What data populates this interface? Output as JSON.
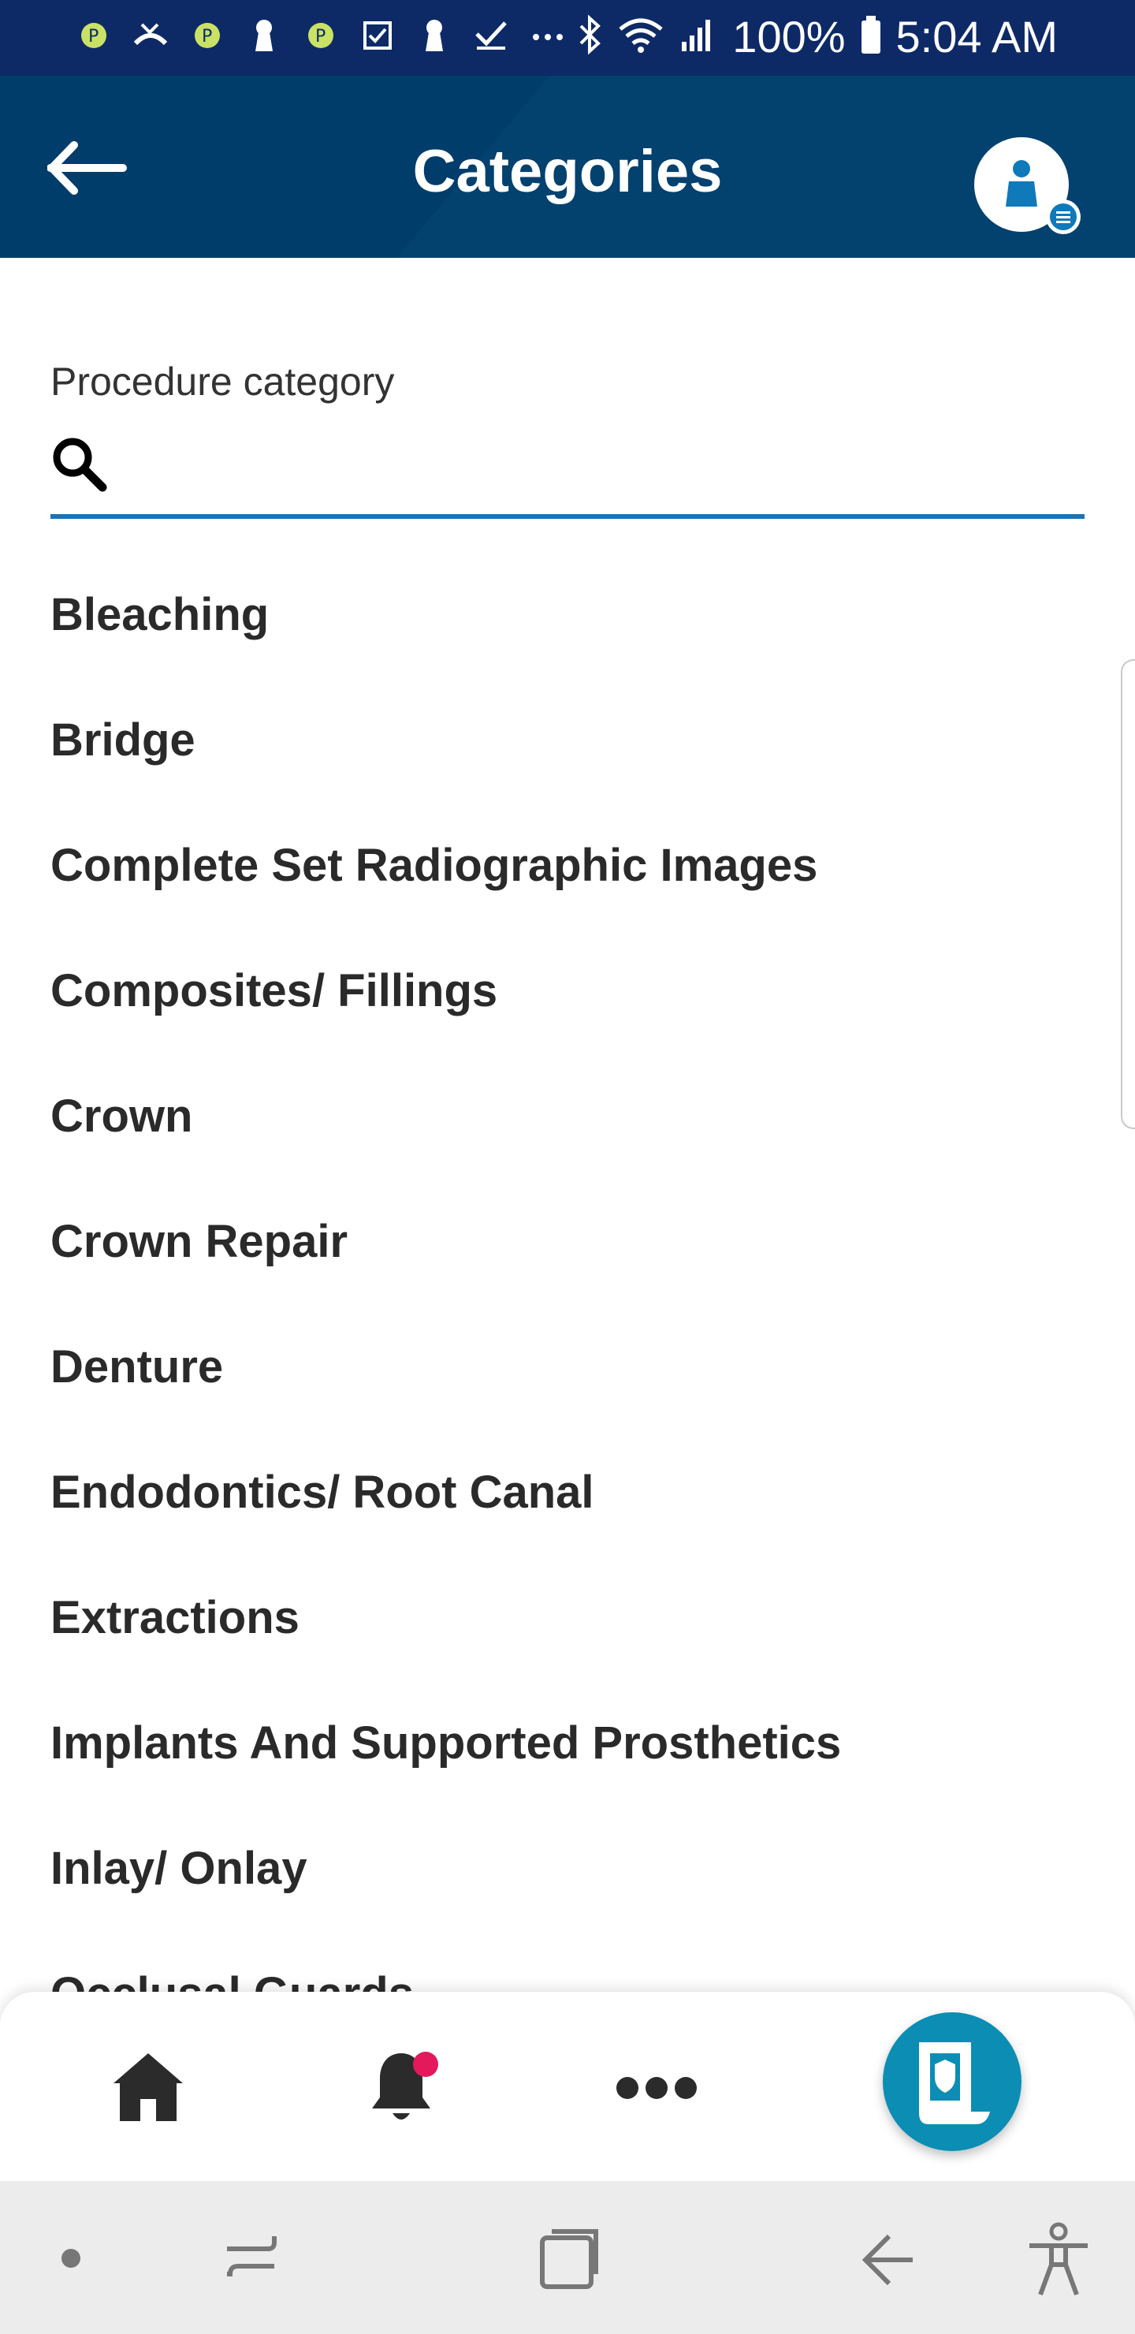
{
  "status_bar": {
    "battery": "100%",
    "time": "5:04 AM",
    "left_icons": [
      "app-icon",
      "missed-call-icon",
      "app-icon",
      "keyhole-icon",
      "app-icon",
      "checkbox-icon",
      "keyhole-icon",
      "check-icon",
      "more-dots-icon"
    ],
    "right_icons": [
      "bluetooth-icon",
      "wifi-icon",
      "signal-icon",
      "battery-icon"
    ]
  },
  "header": {
    "title": "Categories",
    "back_icon": "arrow-left-icon",
    "profile_icon": "user-avatar-icon"
  },
  "search": {
    "label": "Procedure category",
    "value": "",
    "placeholder": ""
  },
  "categories": [
    "Bleaching",
    "Bridge",
    "Complete Set Radiographic Images",
    "Composites/ Fillings",
    "Crown",
    "Crown Repair",
    "Denture",
    "Endodontics/ Root Canal",
    "Extractions",
    "Implants And Supported Prosthetics",
    "Inlay/ Onlay",
    "Occlusal Guards"
  ],
  "bottom_nav": {
    "items": [
      "home-icon",
      "bell-icon",
      "more-icon",
      "id-card-icon"
    ],
    "notification_dot": true
  },
  "colors": {
    "status_bar": "#0e2a66",
    "header": "#003d6b",
    "accent": "#1a73b8",
    "fab": "#0b8db4",
    "notification": "#e3195c"
  }
}
